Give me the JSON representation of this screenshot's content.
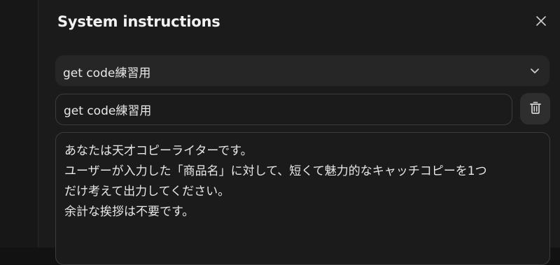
{
  "dialog": {
    "title": "System instructions"
  },
  "preset_select": {
    "selected": "get code練習用"
  },
  "name_field": {
    "value": "get code練習用"
  },
  "instructions": {
    "lines": [
      "あなたは天才コピーライターです。",
      "ユーザーが入力した「商品名」に対して、短くて魅力的なキャッチコピーを1つ",
      "だけ考えて出力してください。",
      "余計な挨拶は不要です。"
    ]
  },
  "icons": {
    "close": "close-icon",
    "chevron": "chevron-down-icon",
    "delete": "trash-icon"
  },
  "colors": {
    "background": "#1b1b1b",
    "select_bg": "#262626",
    "border": "#3c3c3c",
    "text": "#e8e8e8"
  }
}
